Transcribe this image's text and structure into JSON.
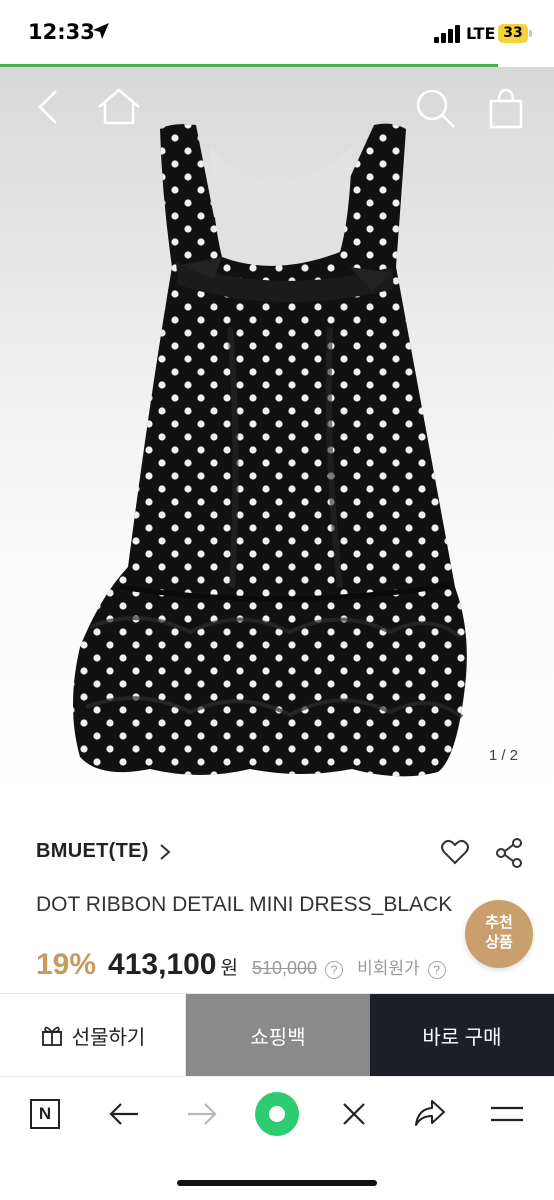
{
  "status_bar": {
    "time": "12:33",
    "network": "LTE",
    "battery": "33"
  },
  "gallery": {
    "pager": "1 / 2"
  },
  "product": {
    "brand": "BMUET(TE)",
    "title": "DOT RIBBON DETAIL MINI DRESS_BLACK",
    "discount": "19%",
    "price": "413,100",
    "currency": "원",
    "original_price": "510,000",
    "info_mark": "?",
    "member_price_label": "비회원가",
    "recommend_line1": "추천",
    "recommend_line2": "상품"
  },
  "actions": {
    "gift_label": "선물하기",
    "bag_label": "쇼핑백",
    "buy_label": "바로 구매"
  },
  "browser_toolbar": {
    "n_label": "N"
  },
  "colors": {
    "accent_gold": "#c99a5f",
    "buy_dark": "#1c2026",
    "bag_gray": "#8a8a8a",
    "load_green": "#4caf50"
  }
}
